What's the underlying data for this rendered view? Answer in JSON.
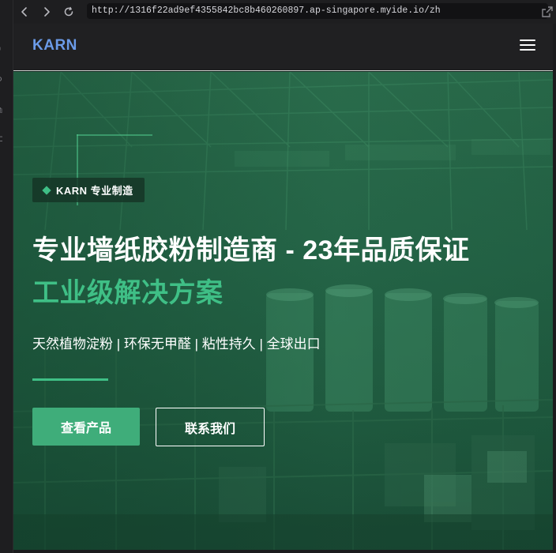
{
  "browser": {
    "url": "http://1316f22ad9ef4355842bc8b460260897.ap-singapore.myide.io/zh",
    "back_icon": "chevron-left-icon",
    "forward_icon": "chevron-right-icon",
    "reload_icon": "reload-icon",
    "open_external_icon": "open-external-icon"
  },
  "header": {
    "logo": "KARN",
    "menu_icon": "hamburger-menu-icon",
    "logo_color": "#6b9be8"
  },
  "hero": {
    "badge": "KARN 专业制造",
    "title": "专业墙纸胶粉制造商 - 23年品质保证",
    "subtitle": "工业级解决方案",
    "tagline": "天然植物淀粉 | 环保无甲醛 | 粘性持久 | 全球出口",
    "primary_button": "查看产品",
    "secondary_button": "联系我们",
    "accent_color": "#3fbf86"
  }
}
